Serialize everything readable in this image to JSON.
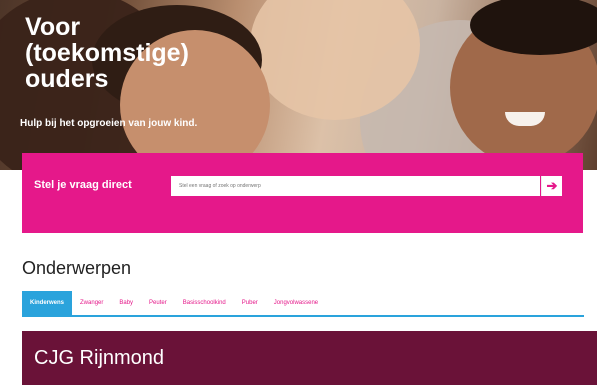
{
  "hero": {
    "title": "Voor\n(toekomstige)\nouders",
    "subtitle": "Hulp bij het opgroeien van jouw kind."
  },
  "ask": {
    "label": "Stel je vraag direct",
    "placeholder": "Stel een vraag of zoek op onderwerp",
    "submit_icon": "arrow-right-icon",
    "submit_glyph": "➔"
  },
  "topics": {
    "title": "Onderwerpen",
    "tabs": [
      "Kinderwens",
      "Zwanger",
      "Baby",
      "Peuter",
      "Basisschoolkind",
      "Puber",
      "Jongvolwassene"
    ],
    "active_tab": 0
  },
  "caption": {
    "text": "CJG Rijnmond"
  },
  "colors": {
    "brand_pink": "#e5188a",
    "tab_blue": "#2aa3dc",
    "caption_bg": "#6a1238"
  }
}
